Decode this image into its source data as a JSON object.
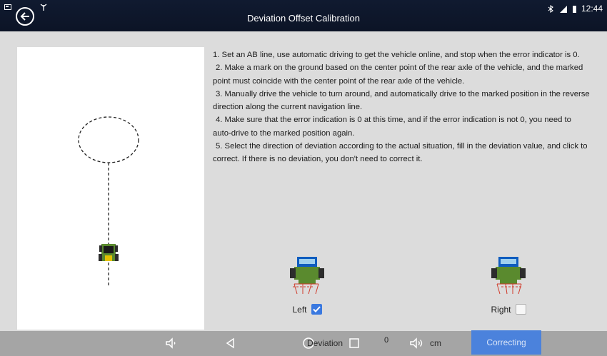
{
  "header": {
    "title": "Deviation Offset Calibration",
    "time": "12:44"
  },
  "instructions": [
    "1. Set an AB line, use automatic driving to get the vehicle online, and stop when the error indicator is 0.",
    "2. Make a mark on the ground based on the center point of the rear axle of the vehicle, and the marked point must coincide with the center point of the rear axle of the vehicle.",
    "3. Manually drive the vehicle to turn around, and automatically drive to the marked position in the reverse direction along the current navigation line.",
    "4. Make sure that the error indication is 0 at this time, and if the error indication is not 0, you need to auto-drive to the marked position again.",
    "5. Select the direction of deviation according to the actual situation, fill in the deviation value, and click to correct. If there is no deviation, you don't need to correct it."
  ],
  "options": {
    "left": {
      "label": "Left",
      "checked": true
    },
    "right": {
      "label": "Right",
      "checked": false
    }
  },
  "deviation": {
    "label": "Deviation",
    "value": "0",
    "unit": "cm"
  },
  "correct_button": "Correcting",
  "colors": {
    "accent": "#3a79e0",
    "header_bg": "#0f182c",
    "tractor_body": "#5a8a2e",
    "cab_blue": "#0f5dbf",
    "offset_red": "#d13b2b"
  }
}
